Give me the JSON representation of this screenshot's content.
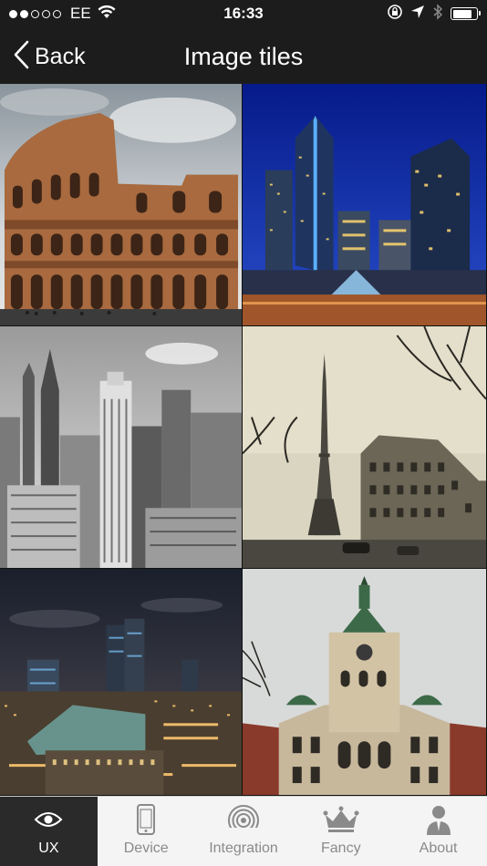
{
  "status_bar": {
    "carrier": "EE",
    "time": "16:33",
    "signal_bars_filled": 2,
    "signal_bars_total": 5,
    "battery_level": 0.8
  },
  "nav": {
    "back_label": "Back",
    "title": "Image tiles"
  },
  "tiles": [
    {
      "icon": "colosseum-photo"
    },
    {
      "icon": "city-skyline-night-photo"
    },
    {
      "icon": "new-york-skyscrapers-photo"
    },
    {
      "icon": "eiffel-tower-photo"
    },
    {
      "icon": "city-night-panorama-photo"
    },
    {
      "icon": "bavarian-museum-building-photo"
    }
  ],
  "tabs": [
    {
      "label": "UX",
      "icon": "eye-icon",
      "active": true
    },
    {
      "label": "Device",
      "icon": "phone-icon",
      "active": false
    },
    {
      "label": "Integration",
      "icon": "wireless-icon",
      "active": false
    },
    {
      "label": "Fancy",
      "icon": "crown-icon",
      "active": false
    },
    {
      "label": "About",
      "icon": "person-icon",
      "active": false
    }
  ],
  "colors": {
    "bar_background": "#1c1c1c",
    "tab_background": "#f4f4f4",
    "tab_active": "#2a2a2a",
    "tab_inactive_text": "#8a8a8a"
  }
}
